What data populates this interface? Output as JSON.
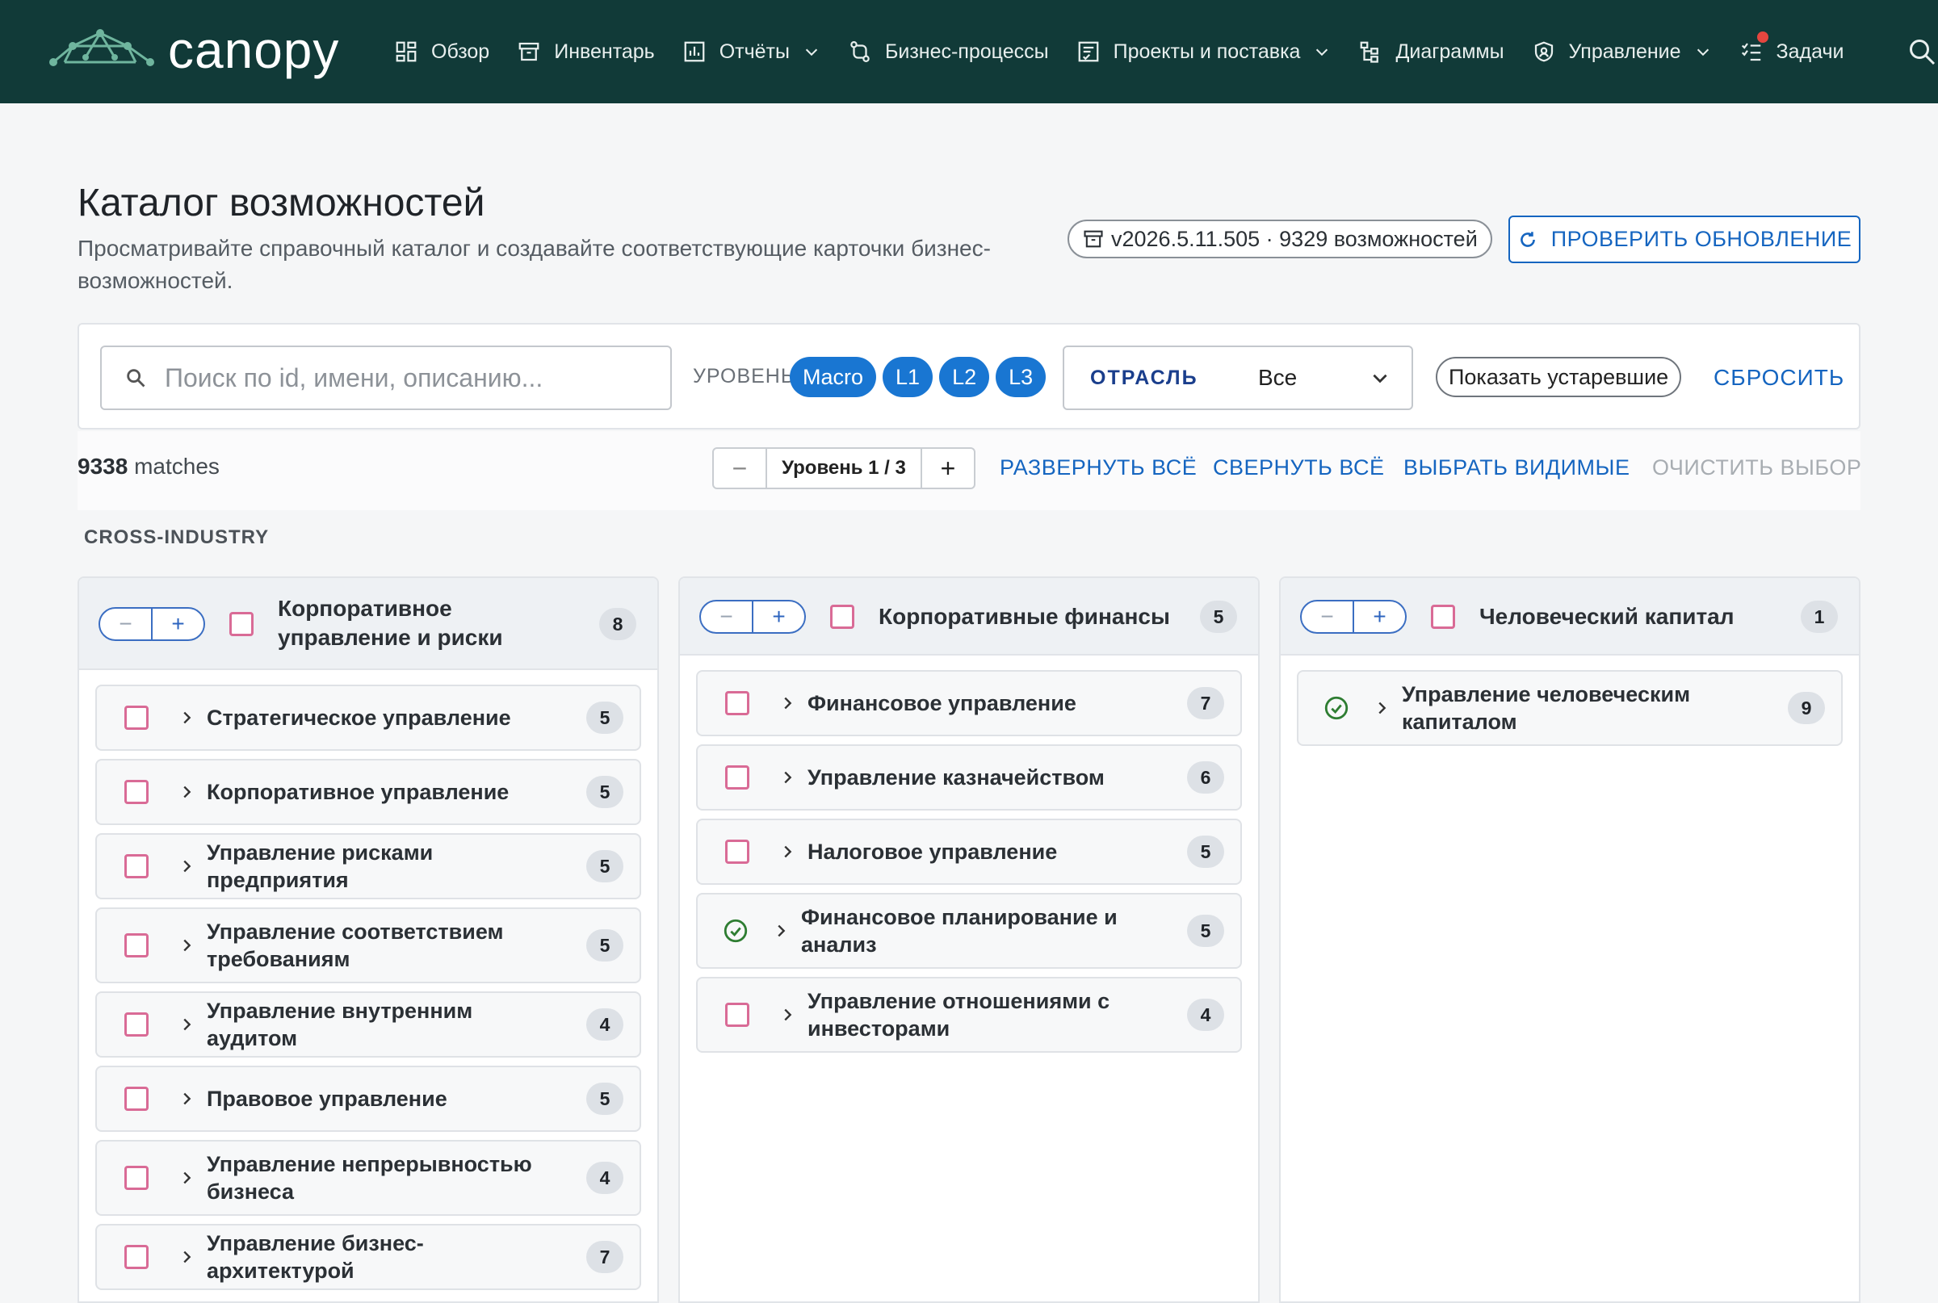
{
  "app": {
    "logo_text": "canopy",
    "nav": [
      {
        "label": "Обзор",
        "icon": "dashboard-icon",
        "dropdown": false
      },
      {
        "label": "Инвентарь",
        "icon": "archive-icon",
        "dropdown": false
      },
      {
        "label": "Отчёты",
        "icon": "reports-icon",
        "dropdown": true
      },
      {
        "label": "Бизнес-процессы",
        "icon": "flow-icon",
        "dropdown": false
      },
      {
        "label": "Проекты и поставка",
        "icon": "project-icon",
        "dropdown": true
      },
      {
        "label": "Диаграммы",
        "icon": "diagram-icon",
        "dropdown": false
      },
      {
        "label": "Управление",
        "icon": "shield-icon",
        "dropdown": true
      },
      {
        "label": "Задачи",
        "icon": "tasks-icon",
        "dropdown": false,
        "notification": true
      }
    ]
  },
  "header": {
    "title": "Каталог возможностей",
    "subtitle": "Просматривайте справочный каталог и создавайте соответствующие карточки бизнес-возможностей.",
    "version": "v2026.5.11.505 · 9329 возможностей",
    "check_update": "ПРОВЕРИТЬ ОБНОВЛЕНИЕ"
  },
  "filters": {
    "search_placeholder": "Поиск по id, имени, описанию...",
    "level_label": "УРОВЕНЬ",
    "levels": [
      "Macro",
      "L1",
      "L2",
      "L3"
    ],
    "industry_label": "ОТРАСЛЬ",
    "industry_value": "Все",
    "show_obsolete": "Показать устаревшие",
    "reset": "СБРОСИТЬ"
  },
  "toolbar": {
    "matches_count": "9338",
    "matches_word": "matches",
    "level_stepper": "Уровень 1 / 3",
    "expand_all": "РАЗВЕРНУТЬ ВСЁ",
    "collapse_all": "СВЕРНУТЬ ВСЁ",
    "select_visible": "ВЫБРАТЬ ВИДИМЫЕ",
    "clear_selection": "ОЧИСТИТЬ ВЫБОР"
  },
  "section": "CROSS-INDUSTRY",
  "columns": [
    {
      "title": "Корпоративное управление и риски",
      "count": "8",
      "items": [
        {
          "label": "Стратегическое управление",
          "count": "5",
          "done": false
        },
        {
          "label": "Корпоративное управление",
          "count": "5",
          "done": false
        },
        {
          "label": "Управление рисками предприятия",
          "count": "5",
          "done": false
        },
        {
          "label": "Управление соответствием требованиям",
          "count": "5",
          "done": false
        },
        {
          "label": "Управление внутренним аудитом",
          "count": "4",
          "done": false
        },
        {
          "label": "Правовое управление",
          "count": "5",
          "done": false
        },
        {
          "label": "Управление непрерывностью бизнеса",
          "count": "4",
          "done": false
        },
        {
          "label": "Управление бизнес-архитектурой",
          "count": "7",
          "done": false
        }
      ]
    },
    {
      "title": "Корпоративные финансы",
      "count": "5",
      "items": [
        {
          "label": "Финансовое управление",
          "count": "7",
          "done": false
        },
        {
          "label": "Управление казначейством",
          "count": "6",
          "done": false
        },
        {
          "label": "Налоговое управление",
          "count": "5",
          "done": false
        },
        {
          "label": "Финансовое планирование и анализ",
          "count": "5",
          "done": true
        },
        {
          "label": "Управление отношениями с инвесторами",
          "count": "4",
          "done": false
        }
      ]
    },
    {
      "title": "Человеческий капитал",
      "count": "1",
      "items": [
        {
          "label": "Управление человеческим капиталом",
          "count": "9",
          "done": true
        }
      ]
    }
  ],
  "colors": {
    "nav_bg": "#113a38",
    "accent": "#1976d2",
    "checkbox": "#d96b96",
    "done": "#2e7d32"
  }
}
